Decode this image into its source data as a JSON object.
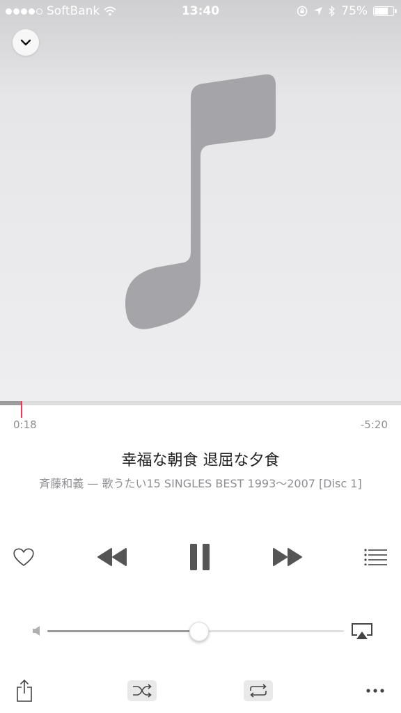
{
  "status_bar": {
    "carrier": "SoftBank",
    "time": "13:40",
    "battery_percent": "75%",
    "battery_level": 0.75,
    "signal_bars": 4,
    "icons": [
      "wifi-icon",
      "rotation-lock-icon",
      "location-arrow-icon",
      "bluetooth-icon",
      "battery-icon"
    ]
  },
  "artwork": {
    "placeholder_icon": "music-note-icon",
    "collapse_icon": "chevron-down-icon"
  },
  "playback": {
    "elapsed": "0:18",
    "remaining": "-5:20",
    "progress": 0.054,
    "accent_color": "#ff2d55"
  },
  "track": {
    "title": "幸福な朝食 退屈な夕食",
    "subtitle": "斉藤和義 — 歌うたい15 SINGLES BEST 1993〜2007 [Disc 1]"
  },
  "controls": {
    "icons": [
      "heart-icon",
      "rewind-icon",
      "pause-icon",
      "fast-forward-icon",
      "queue-list-icon"
    ]
  },
  "volume": {
    "level": 0.51,
    "icons": [
      "speaker-low-icon",
      "airplay-icon"
    ]
  },
  "bottom_bar": {
    "icons": [
      "share-icon",
      "shuffle-icon",
      "repeat-icon",
      "more-icon"
    ]
  }
}
